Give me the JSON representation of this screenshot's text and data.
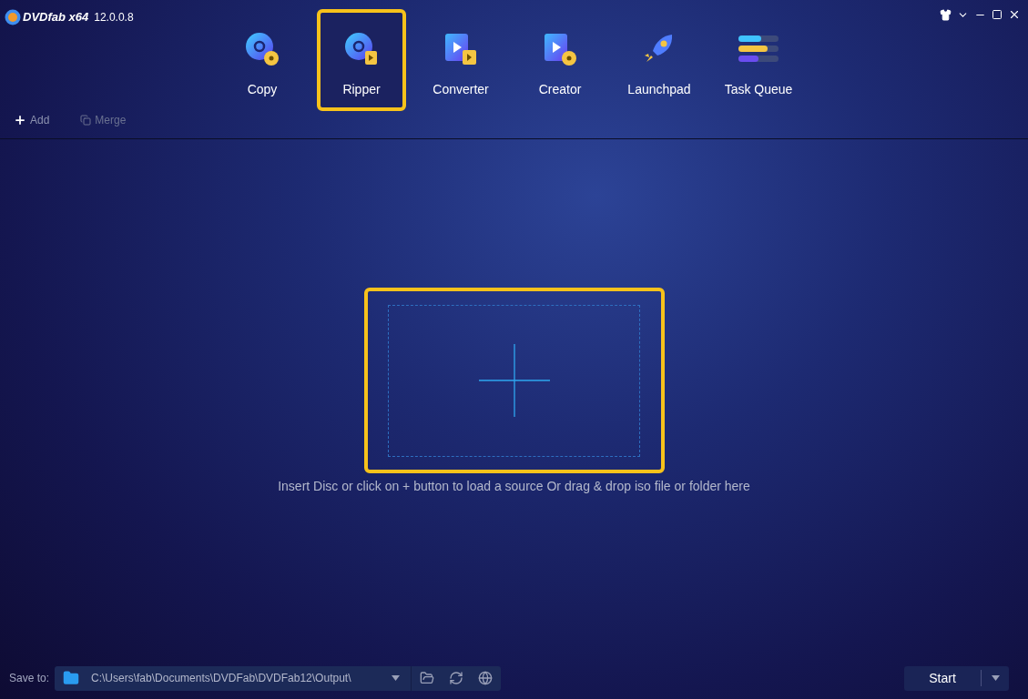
{
  "app": {
    "logo": "DVDfab x64",
    "version": "12.0.0.8"
  },
  "tabs": [
    {
      "kind": "copy",
      "label": "Copy",
      "selected": false
    },
    {
      "kind": "ripper",
      "label": "Ripper",
      "selected": true
    },
    {
      "kind": "converter",
      "label": "Converter",
      "selected": false
    },
    {
      "kind": "creator",
      "label": "Creator",
      "selected": false
    },
    {
      "kind": "launchpad",
      "label": "Launchpad",
      "selected": false
    },
    {
      "kind": "queue",
      "label": "Task Queue",
      "selected": false
    }
  ],
  "toolbar": [
    {
      "kind": "add",
      "label": "Add",
      "disabled": false
    },
    {
      "kind": "merge",
      "label": "Merge",
      "disabled": true
    }
  ],
  "drop_zone": {
    "hint": "Insert Disc or click on + button to load a source Or drag & drop iso file or folder here"
  },
  "save_to": {
    "label": "Save to:",
    "path": "C:\\Users\\fab\\Documents\\DVDFab\\DVDFab12\\Output\\"
  },
  "start_button": "Start"
}
